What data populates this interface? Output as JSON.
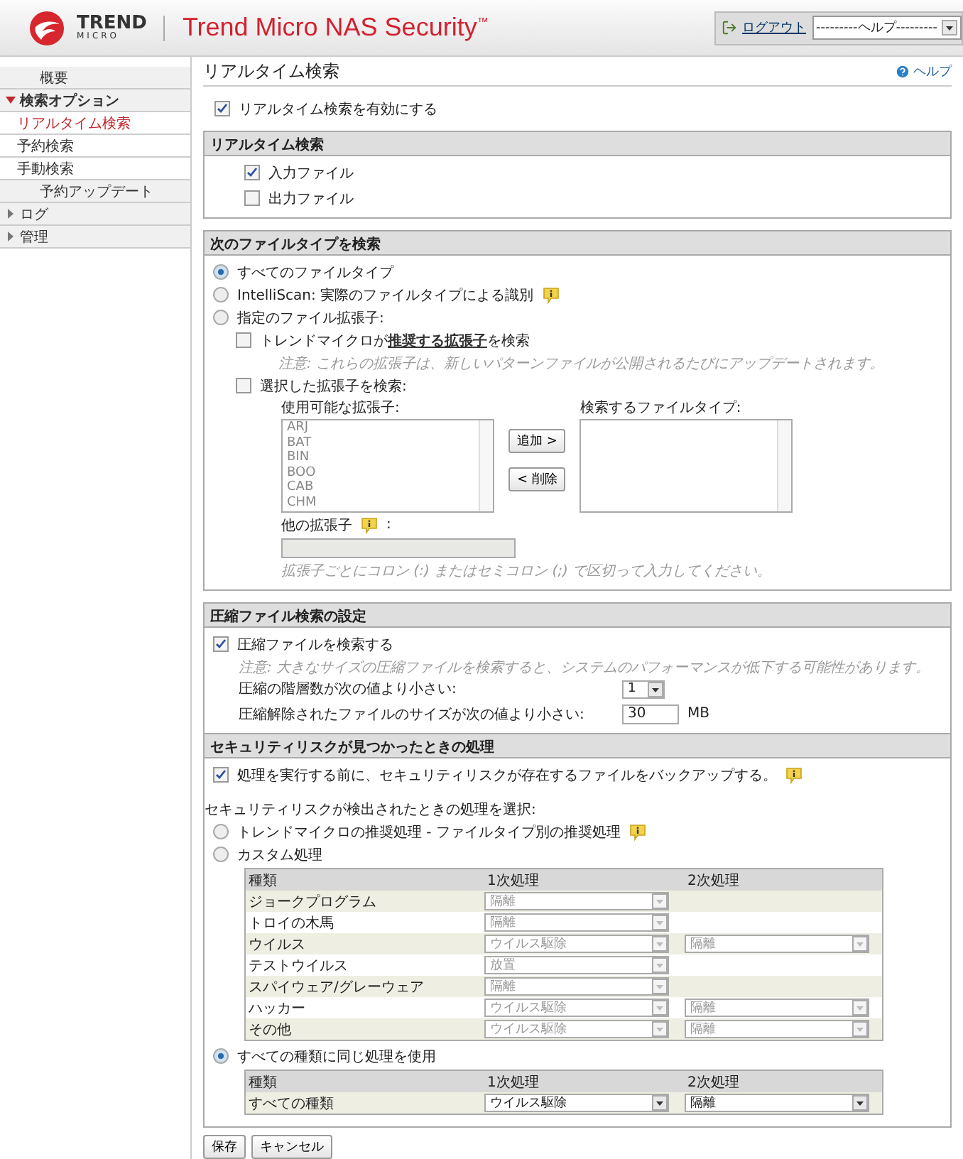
{
  "header": {
    "logo_top": "TREND",
    "logo_bottom": "MICRO",
    "product": "Trend Micro NAS Security",
    "trademark": "™",
    "logout": "ログアウト",
    "help_select": "---------ヘルプ---------"
  },
  "sidebar": {
    "items": [
      {
        "kind": "link",
        "label": "概要"
      },
      {
        "kind": "group",
        "label": "検索オプション",
        "expanded": true,
        "children": [
          {
            "label": "リアルタイム検索",
            "selected": true
          },
          {
            "label": "予約検索",
            "selected": false
          },
          {
            "label": "手動検索",
            "selected": false
          }
        ]
      },
      {
        "kind": "link",
        "label": "予約アップデート"
      },
      {
        "kind": "group",
        "label": "ログ",
        "expanded": false
      },
      {
        "kind": "group",
        "label": "管理",
        "expanded": false
      }
    ]
  },
  "page": {
    "title": "リアルタイム検索",
    "help": "ヘルプ"
  },
  "enable": {
    "label": "リアルタイム検索を有効にする",
    "checked": true
  },
  "realtime_section": {
    "title": "リアルタイム検索",
    "options": [
      {
        "label": "入力ファイル",
        "checked": true
      },
      {
        "label": "出力ファイル",
        "checked": false
      }
    ]
  },
  "file_types": {
    "title": "次のファイルタイプを検索",
    "choices": [
      {
        "label": "すべてのファイルタイプ",
        "selected": true,
        "info": false
      },
      {
        "label": "IntelliScan: 実際のファイルタイプによる識別",
        "selected": false,
        "info": true
      },
      {
        "label": "指定のファイル拡張子:",
        "selected": false,
        "info": false
      }
    ],
    "recommended": {
      "checked": false,
      "before": "トレンドマイクロが",
      "link": "推奨する拡張子",
      "after": "を検索",
      "note": "注意: これらの拡張子は、新しいパターンファイルが公開されるたびにアップデートされます。"
    },
    "selected_ext": {
      "checked": false,
      "label": "選択した拡張子を検索:",
      "available_label": "使用可能な拡張子:",
      "available": [
        "ARJ",
        "BAT",
        "BIN",
        "BOO",
        "CAB",
        "CHM"
      ],
      "add": "追加 >",
      "remove": "< 削除",
      "target_label": "検索するファイルタイプ:",
      "other_label": "他の拡張子",
      "other_colon": ":",
      "hint": "拡張子ごとにコロン (:) またはセミコロン (;) で区切って入力してください。"
    }
  },
  "compression": {
    "title": "圧縮ファイル検索の設定",
    "checked": true,
    "label": "圧縮ファイルを検索する",
    "note": "注意: 大きなサイズの圧縮ファイルを検索すると、システムのパフォーマンスが低下する可能性があります。",
    "depth_label": "圧縮の階層数が次の値より小さい:",
    "depth_value": "1",
    "size_label": "圧縮解除されたファイルのサイズが次の値より小さい:",
    "size_value": "30",
    "size_unit": "MB"
  },
  "actions": {
    "title": "セキュリティリスクが見つかったときの処理",
    "backup": {
      "checked": true,
      "label": "処理を実行する前に、セキュリティリスクが存在するファイルをバックアップする。",
      "info": true
    },
    "choose_label": "セキュリティリスクが検出されたときの処理を選択:",
    "choices": [
      {
        "label": "トレンドマイクロの推奨処理 - ファイルタイプ別の推奨処理",
        "selected": false,
        "info": true
      },
      {
        "label": "カスタム処理",
        "selected": false,
        "info": false,
        "table": {
          "disabled": true,
          "columns": [
            "種類",
            "1次処理",
            "2次処理"
          ],
          "rows": [
            {
              "type": "ジョークプログラム",
              "first": "隔離"
            },
            {
              "type": "トロイの木馬",
              "first": "隔離"
            },
            {
              "type": "ウイルス",
              "first": "ウイルス駆除",
              "second": "隔離"
            },
            {
              "type": "テストウイルス",
              "first": "放置"
            },
            {
              "type": "スパイウェア/グレーウェア",
              "first": "隔離"
            },
            {
              "type": "ハッカー",
              "first": "ウイルス駆除",
              "second": "隔離"
            },
            {
              "type": "その他",
              "first": "ウイルス駆除",
              "second": "隔離"
            }
          ]
        }
      },
      {
        "label": "すべての種類に同じ処理を使用",
        "selected": true,
        "info": false,
        "table": {
          "disabled": false,
          "columns": [
            "種類",
            "1次処理",
            "2次処理"
          ],
          "rows": [
            {
              "type": "すべての種類",
              "first": "ウイルス駆除",
              "second": "隔離"
            }
          ]
        }
      }
    ]
  },
  "buttons": [
    "保存",
    "キャンセル"
  ]
}
